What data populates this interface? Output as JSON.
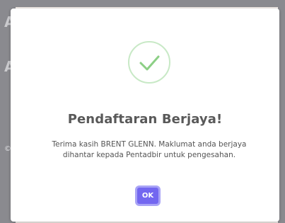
{
  "background": {
    "partial_letter_top": "A",
    "partial_letter_mid": "A",
    "partial_copyright": "©"
  },
  "modal": {
    "icon": "check-icon",
    "title": "Pendaftaran Berjaya!",
    "message": "Terima kasih BRENT GLENN. Maklumat anda berjaya dihantar kepada Pentadbir untuk pengesahan.",
    "ok_label": "OK"
  },
  "colors": {
    "accent": "#7367f0",
    "success": "#8ccf85",
    "success_ring": "#c8e9c6",
    "title": "#595959",
    "overlay": "#8a8a8f"
  }
}
